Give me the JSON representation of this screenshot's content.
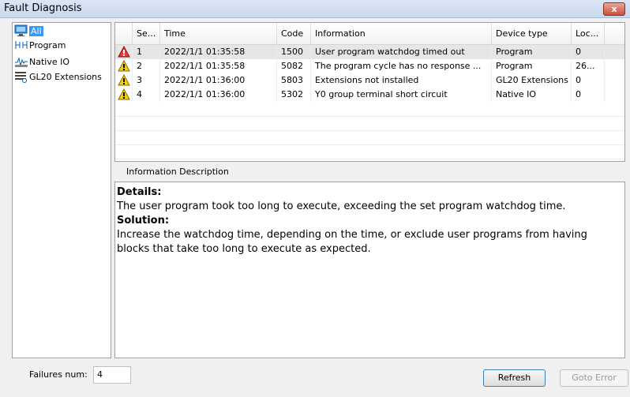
{
  "window": {
    "title": "Fault Diagnosis",
    "close_label": "x"
  },
  "tree": {
    "items": [
      {
        "label": "All",
        "icon": "monitor-icon",
        "selected": true
      },
      {
        "label": "Program",
        "icon": "ladder-icon"
      },
      {
        "label": "Native IO",
        "icon": "signal-icon"
      },
      {
        "label": "GL20 Extensions",
        "icon": "module-icon"
      }
    ]
  },
  "grid": {
    "columns": [
      "Se...",
      "Time",
      "Code",
      "Information",
      "Device type",
      "Loc..."
    ],
    "rows": [
      {
        "icon": "error-icon",
        "seq": "1",
        "time": "2022/1/1 01:35:58",
        "code": "1500",
        "info": "User program watchdog timed out",
        "device": "Program",
        "loc": "0"
      },
      {
        "icon": "warning-icon",
        "seq": "2",
        "time": "2022/1/1 01:35:58",
        "code": "5082",
        "info": "The program cycle has no response ...",
        "device": "Program",
        "loc": "26..."
      },
      {
        "icon": "warning-icon",
        "seq": "3",
        "time": "2022/1/1 01:36:00",
        "code": "5803",
        "info": "Extensions not installed",
        "device": "GL20 Extensions",
        "loc": "0"
      },
      {
        "icon": "warning-icon",
        "seq": "4",
        "time": "2022/1/1 01:36:00",
        "code": "5302",
        "info": "Y0 group terminal short circuit",
        "device": "Native IO",
        "loc": "0"
      }
    ]
  },
  "info": {
    "label": "Information Description",
    "details_heading": "Details:",
    "details_text": "The user program took too long to execute, exceeding the set program watchdog time.",
    "solution_heading": "Solution:",
    "solution_text": "Increase the watchdog time, depending on the time, or exclude user programs from having blocks that take too long to execute as expected."
  },
  "footer": {
    "failures_label": "Failures num:",
    "failures_value": "4",
    "refresh_label": "Refresh",
    "goto_label": "Goto Error"
  }
}
